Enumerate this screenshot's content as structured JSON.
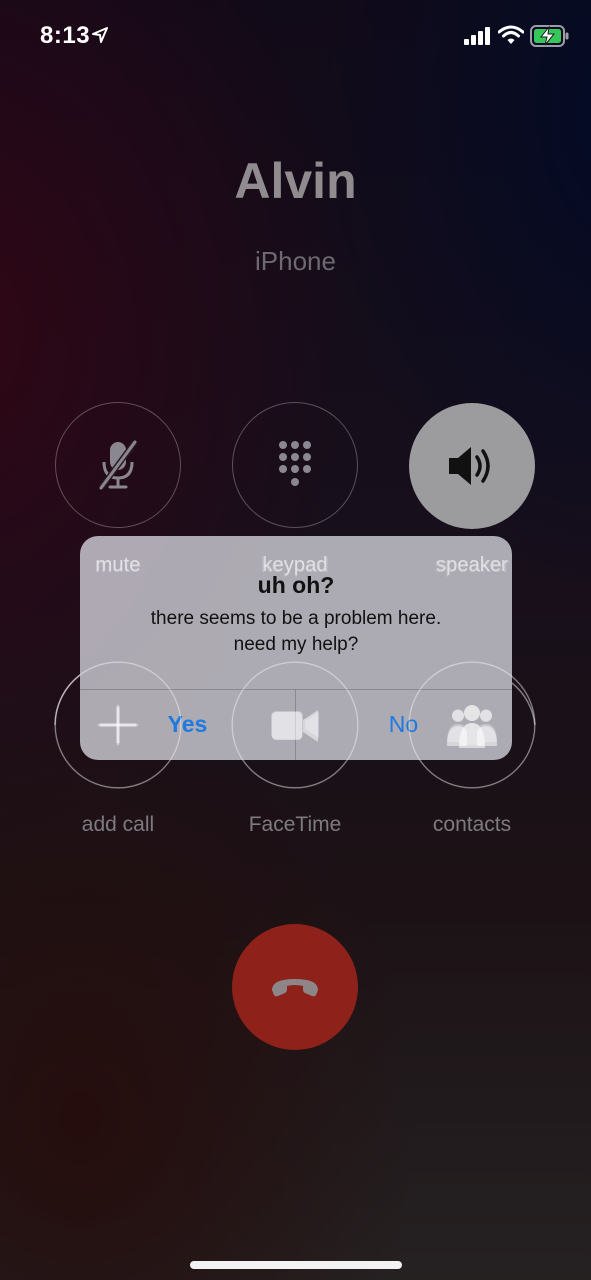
{
  "status_bar": {
    "time": "8:13",
    "icons": [
      "location-arrow-icon",
      "cellular-signal-icon",
      "wifi-icon",
      "battery-charging-icon"
    ]
  },
  "call": {
    "caller_name": "Alvin",
    "subtitle": "iPhone"
  },
  "controls": [
    {
      "label": "mute",
      "icon": "mic-slash-icon"
    },
    {
      "label": "keypad",
      "icon": "keypad-icon"
    },
    {
      "label": "speaker",
      "icon": "speaker-icon"
    },
    {
      "label": "add call",
      "icon": "plus-icon"
    },
    {
      "label": "FaceTime",
      "icon": "video-camera-icon"
    },
    {
      "label": "contacts",
      "icon": "contacts-icon"
    }
  ],
  "end_call": {
    "icon": "phone-hangup-icon",
    "color": "#8e2119"
  },
  "alert": {
    "title": "uh oh?",
    "message_line1": "there seems to be a problem here.",
    "message_line2": "need my help?",
    "yes_label": "Yes",
    "no_label": "No",
    "button_color": "#1f7ae0"
  }
}
